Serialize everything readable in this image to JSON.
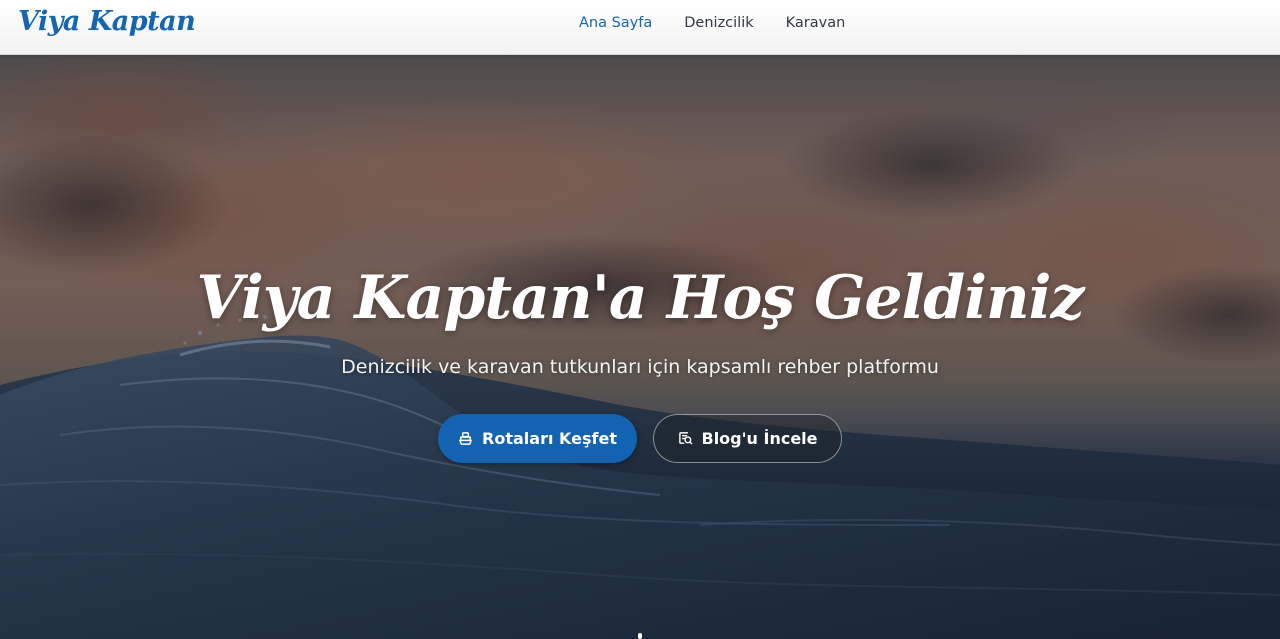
{
  "navbar": {
    "logo": "Viya Kaptan",
    "links": [
      {
        "label": "Ana Sayfa",
        "active": true
      },
      {
        "label": "Denizcilik",
        "active": false
      },
      {
        "label": "Karavan",
        "active": false
      }
    ]
  },
  "hero": {
    "title": "Viya Kaptan'a Hoş Geldiniz",
    "subtitle": "Denizcilik ve karavan tutkunları için kapsamlı rehber platformu",
    "buttons": {
      "primary": {
        "label": "Rotaları Keşfet",
        "icon": "ship-icon"
      },
      "secondary": {
        "label": "Blog'u İncele",
        "icon": "blog-search-icon"
      }
    }
  },
  "colors": {
    "brand": "#1565b0",
    "primary_button": "#1463b2",
    "nav_text": "#333a44"
  }
}
